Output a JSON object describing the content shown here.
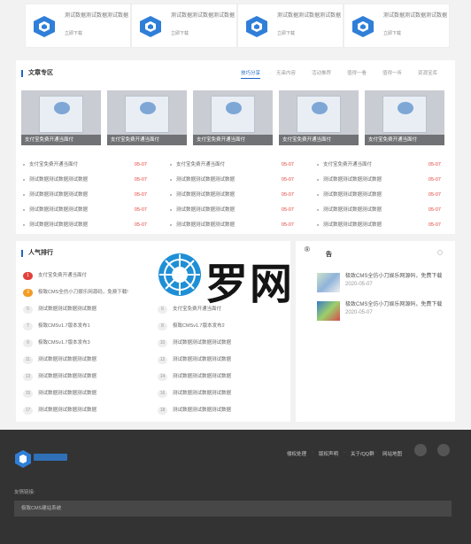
{
  "apps": [
    {
      "title": "测试数据测试数据测试数据",
      "download": "立即下载"
    },
    {
      "title": "测试数据测试数据测试数据",
      "download": "立即下载"
    },
    {
      "title": "测试数据测试数据测试数据",
      "download": "立即下载"
    },
    {
      "title": "测试数据测试数据测试数据",
      "download": "立即下载"
    }
  ],
  "articles": {
    "title": "文章专区",
    "tabs": [
      "技巧分享",
      "无串内容",
      "活动推荐",
      "值得一看",
      "值得一听",
      "资源宝库"
    ],
    "thumbs": [
      "支付宝免费开通当面付",
      "支付宝免费开通当面付",
      "支付宝免费开通当面付",
      "支付宝免费开通当面付",
      "支付宝免费开通当面付"
    ],
    "columns": [
      [
        {
          "text": "支付宝免费开通当面付",
          "date": "05-07"
        },
        {
          "text": "测试数据测试数据测试数据",
          "date": "05-07"
        },
        {
          "text": "测试数据测试数据测试数据",
          "date": "05-07"
        },
        {
          "text": "测试数据测试数据测试数据",
          "date": "05-07"
        },
        {
          "text": "测试数据测试数据测试数据",
          "date": "05-07"
        }
      ],
      [
        {
          "text": "支付宝免费开通当面付",
          "date": "05-07"
        },
        {
          "text": "测试数据测试数据测试数据",
          "date": "05-07"
        },
        {
          "text": "测试数据测试数据测试数据",
          "date": "05-07"
        },
        {
          "text": "测试数据测试数据测试数据",
          "date": "05-07"
        },
        {
          "text": "测试数据测试数据测试数据",
          "date": "05-07"
        }
      ],
      [
        {
          "text": "支付宝免费开通当面付",
          "date": "05-07"
        },
        {
          "text": "测试数据测试数据测试数据",
          "date": "05-07"
        },
        {
          "text": "测试数据测试数据测试数据",
          "date": "05-07"
        },
        {
          "text": "测试数据测试数据测试数据",
          "date": "05-07"
        },
        {
          "text": "测试数据测试数据测试数据",
          "date": "05-07"
        }
      ]
    ]
  },
  "ranking": {
    "title": "人气排行",
    "left": [
      {
        "n": "1",
        "text": "支付宝免费开通当面付"
      },
      {
        "n": "3",
        "text": "极致CMS全仿小刀娱乐网源码，免费下载!"
      },
      {
        "n": "5",
        "text": "测试数据测试数据测试数据"
      },
      {
        "n": "7",
        "text": "极致CMSv1.7版本发布1"
      },
      {
        "n": "9",
        "text": "极致CMSv1.7版本发布3"
      },
      {
        "n": "11",
        "text": "测试数据测试数据测试数据"
      },
      {
        "n": "13",
        "text": "测试数据测试数据测试数据"
      },
      {
        "n": "15",
        "text": "测试数据测试数据测试数据"
      },
      {
        "n": "17",
        "text": "测试数据测试数据测试数据"
      }
    ],
    "right": [
      {
        "n": "6",
        "text": "支付宝免费开通当面付"
      },
      {
        "n": "8",
        "text": "极致CMSv1.7版本发布2"
      },
      {
        "n": "10",
        "text": "测试数据测试数据测试数据"
      },
      {
        "n": "12",
        "text": "测试数据测试数据测试数据"
      },
      {
        "n": "14",
        "text": "测试数据测试数据测试数据"
      },
      {
        "n": "16",
        "text": "测试数据测试数据测试数据"
      },
      {
        "n": "18",
        "text": "测试数据测试数据测试数据"
      }
    ]
  },
  "notice": {
    "title": "告",
    "items": [
      {
        "text": "极致CMS全仿小刀娱乐网源码，免费下载",
        "date": "2020-05-07"
      },
      {
        "text": "极致CMS全仿小刀娱乐网源码，免费下载",
        "date": "2020-05-07"
      }
    ]
  },
  "watermark": {
    "text": "罗网",
    "reg": "®"
  },
  "footer": {
    "links": [
      "侵权处理",
      "版权声明",
      "关于/QQ群",
      "网站地图"
    ],
    "friend_label": "友情链接:",
    "friend_link": "极致CMS建站系统"
  }
}
